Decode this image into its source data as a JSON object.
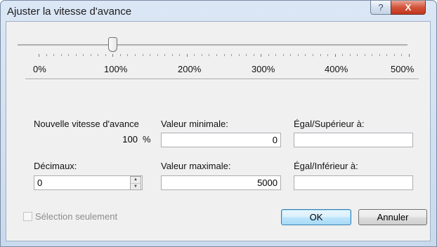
{
  "window": {
    "title": "Ajuster la vitesse d'avance",
    "help_label": "?",
    "close_label": "X"
  },
  "slider": {
    "value_percent": 100,
    "min_percent": 0,
    "max_percent": 500,
    "tick_labels": [
      "0%",
      "100%",
      "200%",
      "300%",
      "400%",
      "500%"
    ]
  },
  "fields": {
    "new_speed_label": "Nouvelle vitesse d'avance",
    "new_speed_value": "100",
    "new_speed_unit": "%",
    "min_label": "Valeur minimale:",
    "min_value": "0",
    "gte_label": "Égal/Supérieur à:",
    "gte_value": "",
    "decimals_label": "Décimaux:",
    "decimals_value": "0",
    "max_label": "Valeur maximale:",
    "max_value": "5000",
    "lte_label": "Égal/Inférieur à:",
    "lte_value": ""
  },
  "selection_only": {
    "label": "Sélection seulement",
    "checked": false
  },
  "buttons": {
    "ok": "OK",
    "cancel": "Annuler"
  }
}
